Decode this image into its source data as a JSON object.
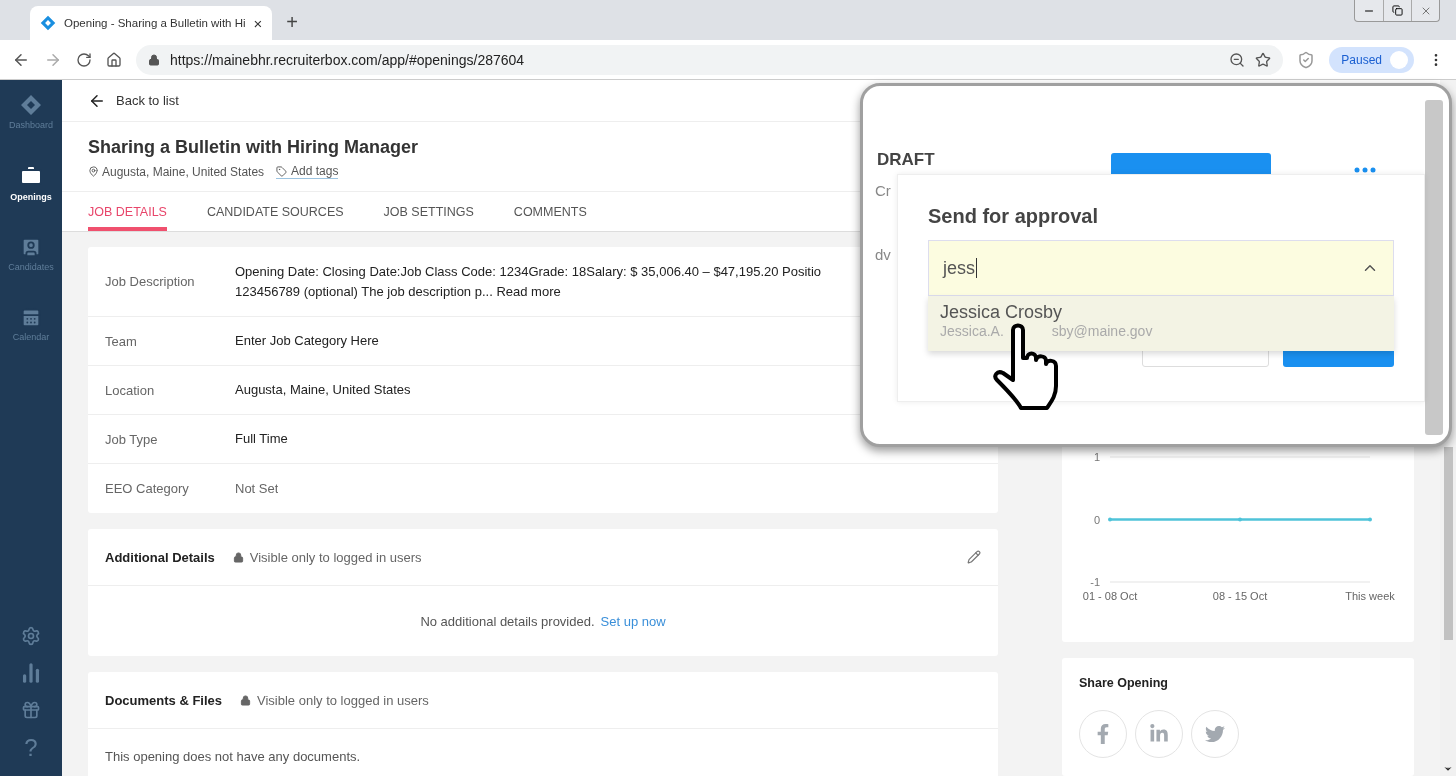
{
  "browser": {
    "tab": {
      "title": "Opening - Sharing a Bulletin with Hi",
      "close": "×"
    },
    "new_tab": "+",
    "url": "https://mainebhr.recruiterbox.com/app/#openings/287604",
    "profile": "Paused"
  },
  "sidebar": {
    "items": [
      {
        "kind": "logo",
        "label": "Dashboard",
        "selected": false
      },
      {
        "kind": "briefcase",
        "label": "Openings",
        "selected": true
      },
      {
        "kind": "candidates",
        "label": "Candidates",
        "selected": false
      },
      {
        "kind": "calendar",
        "label": "Calendar",
        "selected": false
      }
    ],
    "bottom": [
      {
        "kind": "gear"
      },
      {
        "kind": "bars"
      },
      {
        "kind": "gift"
      },
      {
        "kind": "text",
        "text": "?"
      }
    ]
  },
  "back_link": "Back to list",
  "opening": {
    "title": "Sharing a Bulletin with Hiring Manager",
    "location": "Augusta, Maine, United States",
    "add_tags": "Add tags"
  },
  "tabs": [
    {
      "label": "JOB DETAILS",
      "selected": true
    },
    {
      "label": "CANDIDATE SOURCES",
      "selected": false
    },
    {
      "label": "JOB SETTINGS",
      "selected": false
    },
    {
      "label": "COMMENTS",
      "selected": false
    }
  ],
  "job_details": [
    {
      "label": "Job Description",
      "lines": [
        "Opening Date: Closing Date:Job Class Code: 1234Grade: 18Salary: $ 35,006.40 – $47,195.20 Positio",
        "123456789 (optional)   The job description p... Read more"
      ],
      "muted": false
    },
    {
      "label": "Team",
      "lines": [
        "Enter Job Category Here"
      ],
      "muted": false
    },
    {
      "label": "Location",
      "lines": [
        "Augusta, Maine, United States"
      ],
      "muted": false
    },
    {
      "label": "Job Type",
      "lines": [
        "Full Time"
      ],
      "muted": false
    },
    {
      "label": "EEO Category",
      "lines": [
        "Not Set"
      ],
      "muted": true
    }
  ],
  "additional_details": {
    "title": "Additional Details",
    "visibility": "Visible only to logged in users",
    "empty_text": "No additional details provided.",
    "link": "Set up now"
  },
  "documents": {
    "title": "Documents & Files",
    "visibility": "Visible only to logged in users",
    "empty_text": "This opening does not have any documents."
  },
  "chart": {
    "chart_data": {
      "type": "line",
      "categories": [
        "01 - 08 Oct",
        "08 - 15 Oct",
        "This week"
      ],
      "series": [
        {
          "color": "#4fc3d9",
          "values": [
            0,
            0,
            0
          ]
        }
      ],
      "ylim": [
        -1,
        1
      ],
      "yticks": [
        -1,
        0,
        1
      ]
    }
  },
  "share": {
    "title": "Share Opening",
    "networks": [
      {
        "kind": "facebook"
      },
      {
        "kind": "linkedin"
      },
      {
        "kind": "twitter"
      }
    ]
  },
  "magnifier": {
    "status": "DRAFT",
    "status_sub": "Cr",
    "side_text": "dv",
    "popup": {
      "title": "Send for approval",
      "value": "jess",
      "expanded": true,
      "options": [
        {
          "name": "Jessica Crosby",
          "email_parts": [
            "Jessica.A.",
            "sby@maine.gov"
          ],
          "highlighted": true
        }
      ]
    }
  }
}
